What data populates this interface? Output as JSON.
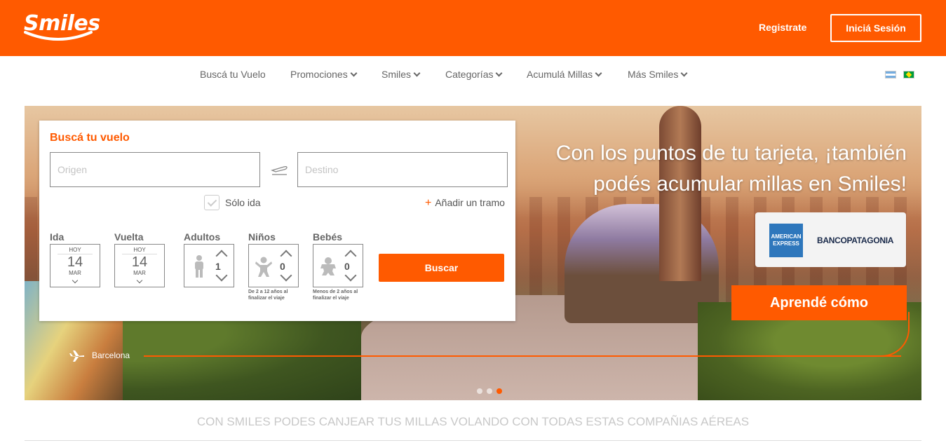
{
  "header": {
    "logo_text": "Smiles",
    "register_label": "Registrate",
    "login_label": "Iniciá Sesión",
    "brand_color": "#ff5a00"
  },
  "nav": {
    "items": [
      {
        "label": "Buscá tu Vuelo",
        "has_dropdown": false
      },
      {
        "label": "Promociones",
        "has_dropdown": true
      },
      {
        "label": "Smiles",
        "has_dropdown": true
      },
      {
        "label": "Categorías",
        "has_dropdown": true
      },
      {
        "label": "Acumulá Millas",
        "has_dropdown": true
      },
      {
        "label": "Más Smiles",
        "has_dropdown": true
      }
    ],
    "flags": [
      "flag-argentina-icon",
      "flag-brazil-icon"
    ]
  },
  "search": {
    "title": "Buscá tu vuelo",
    "origin_placeholder": "Origen",
    "destination_placeholder": "Destino",
    "one_way_label": "Sólo ida",
    "add_leg_label": "Añadir un tramo",
    "departure": {
      "label": "Ida",
      "today": "HOY",
      "day": "14",
      "month": "MAR"
    },
    "return": {
      "label": "Vuelta",
      "today": "HOY",
      "day": "14",
      "month": "MAR"
    },
    "adults": {
      "label": "Adultos",
      "count": "1"
    },
    "children": {
      "label": "Niños",
      "count": "0",
      "note": "De 2 a 12 años al finalizar el viaje"
    },
    "infants": {
      "label": "Bebés",
      "count": "0",
      "note": "Menos de 2 años al finalizar el viaje"
    },
    "submit_label": "Buscar"
  },
  "hero": {
    "headline_line1": "Con los puntos de tu tarjeta, ¡también",
    "headline_line2": "podés acumular millas en Smiles!",
    "amex_label": "AMERICAN EXPRESS",
    "bank_label": "BANCOPATAGONIA",
    "cta_label": "Aprendé cómo",
    "city_label": "Barcelona",
    "slides": 3,
    "active_slide": 3
  },
  "airlines": {
    "title": "CON SMILES PODES CANJEAR TUS MILLAS VOLANDO CON TODAS ESTAS COMPAÑIAS AÉREAS"
  }
}
